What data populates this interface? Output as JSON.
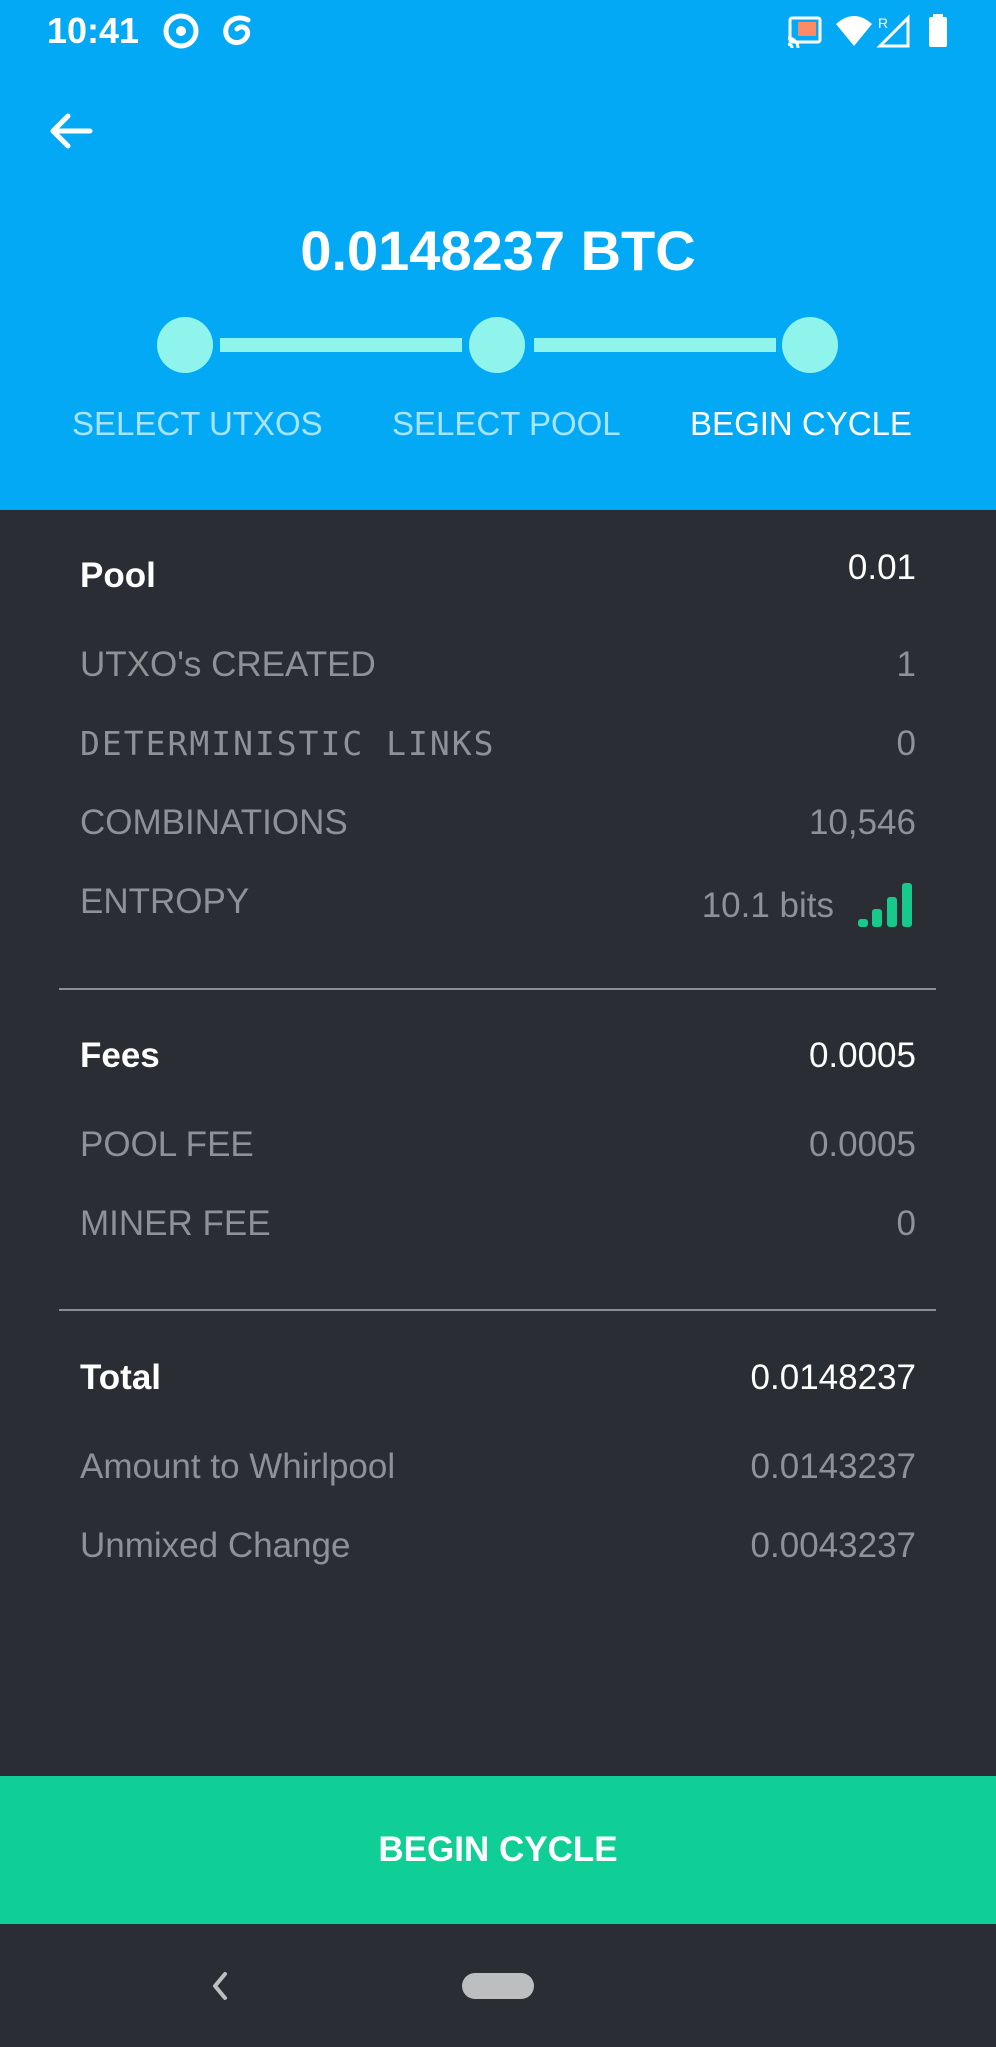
{
  "status_bar": {
    "time": "10:41",
    "icons": [
      "g-circle-icon",
      "swirl-icon",
      "cast-icon",
      "wifi-icon",
      "signal-icon",
      "battery-icon"
    ],
    "signal_badge": "R"
  },
  "header": {
    "amount": "0.0148237 BTC",
    "steps": [
      {
        "label": "SELECT UTXOS",
        "active": false
      },
      {
        "label": "SELECT POOL",
        "active": false
      },
      {
        "label": "BEGIN CYCLE",
        "active": true
      }
    ]
  },
  "pool_section": {
    "title": "Pool",
    "value": "0.01",
    "rows": [
      {
        "label": "UTXO's CREATED",
        "value": "1"
      },
      {
        "label": "DETERMINISTIC LINKS",
        "value": "0"
      },
      {
        "label": "COMBINATIONS",
        "value": "10,546"
      },
      {
        "label": "ENTROPY",
        "value": "10.1 bits"
      }
    ],
    "entropy_level": 4,
    "entropy_max": 4
  },
  "fees_section": {
    "title": "Fees",
    "value": "0.0005",
    "rows": [
      {
        "label": "POOL FEE",
        "value": "0.0005"
      },
      {
        "label": "MINER FEE",
        "value": "0"
      }
    ]
  },
  "total_section": {
    "title": "Total",
    "value": "0.0148237",
    "rows": [
      {
        "label": "Amount to Whirlpool",
        "value": "0.0143237"
      },
      {
        "label": "Unmixed Change",
        "value": "0.0043237"
      }
    ]
  },
  "action": {
    "label": "BEGIN CYCLE"
  },
  "colors": {
    "header_bg": "#03a9f4",
    "step_color": "#8ff5ec",
    "body_bg": "#2a2d33",
    "accent_green": "#10cf96"
  }
}
